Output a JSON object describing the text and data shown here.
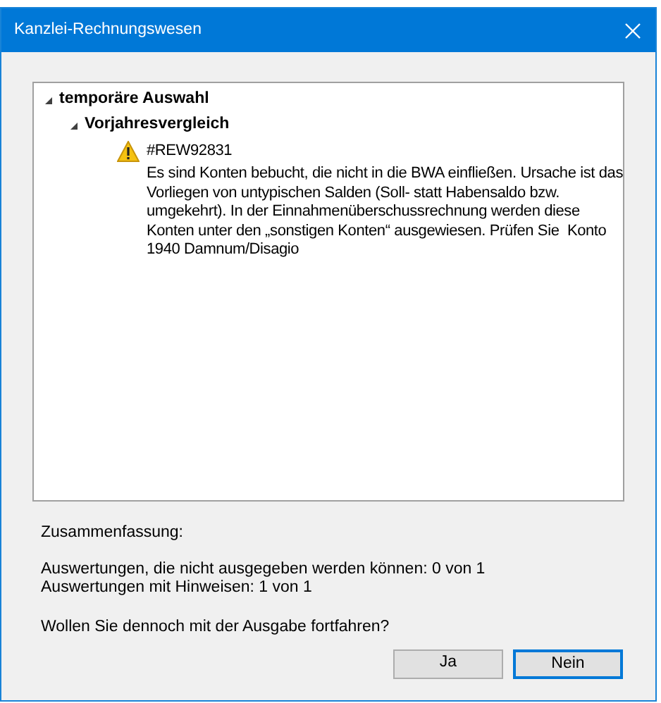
{
  "window": {
    "title": "Kanzlei-Rechnungswesen"
  },
  "tree": [
    {
      "label": "temporäre Auswahl",
      "expanded": true,
      "children": [
        {
          "label": "Vorjahresvergleich",
          "expanded": true,
          "children": [
            {
              "kind": "warning",
              "code": "#REW92831",
              "message": "Es sind Konten bebucht, die nicht in die BWA einfließen. Ursache ist das Vorliegen von untypischen Salden (Soll- statt Habensaldo bzw. umgekehrt). In der Einnahmenüberschussrechnung werden diese Konten unter den „sonstigen Konten“ ausgewiesen. Prüfen Sie  Konto 1940 Damnum/Disagio"
            }
          ]
        }
      ]
    }
  ],
  "summary": {
    "heading": "Zusammenfassung:",
    "lines": [
      "Auswertungen, die nicht ausgegeben werden können: 0 von 1",
      "Auswertungen mit Hinweisen: 1 von 1"
    ],
    "question": "Wollen Sie dennoch mit der Ausgabe fortfahren?"
  },
  "buttons": [
    {
      "label": "Ja",
      "default": false
    },
    {
      "label": "Nein",
      "default": true
    }
  ]
}
